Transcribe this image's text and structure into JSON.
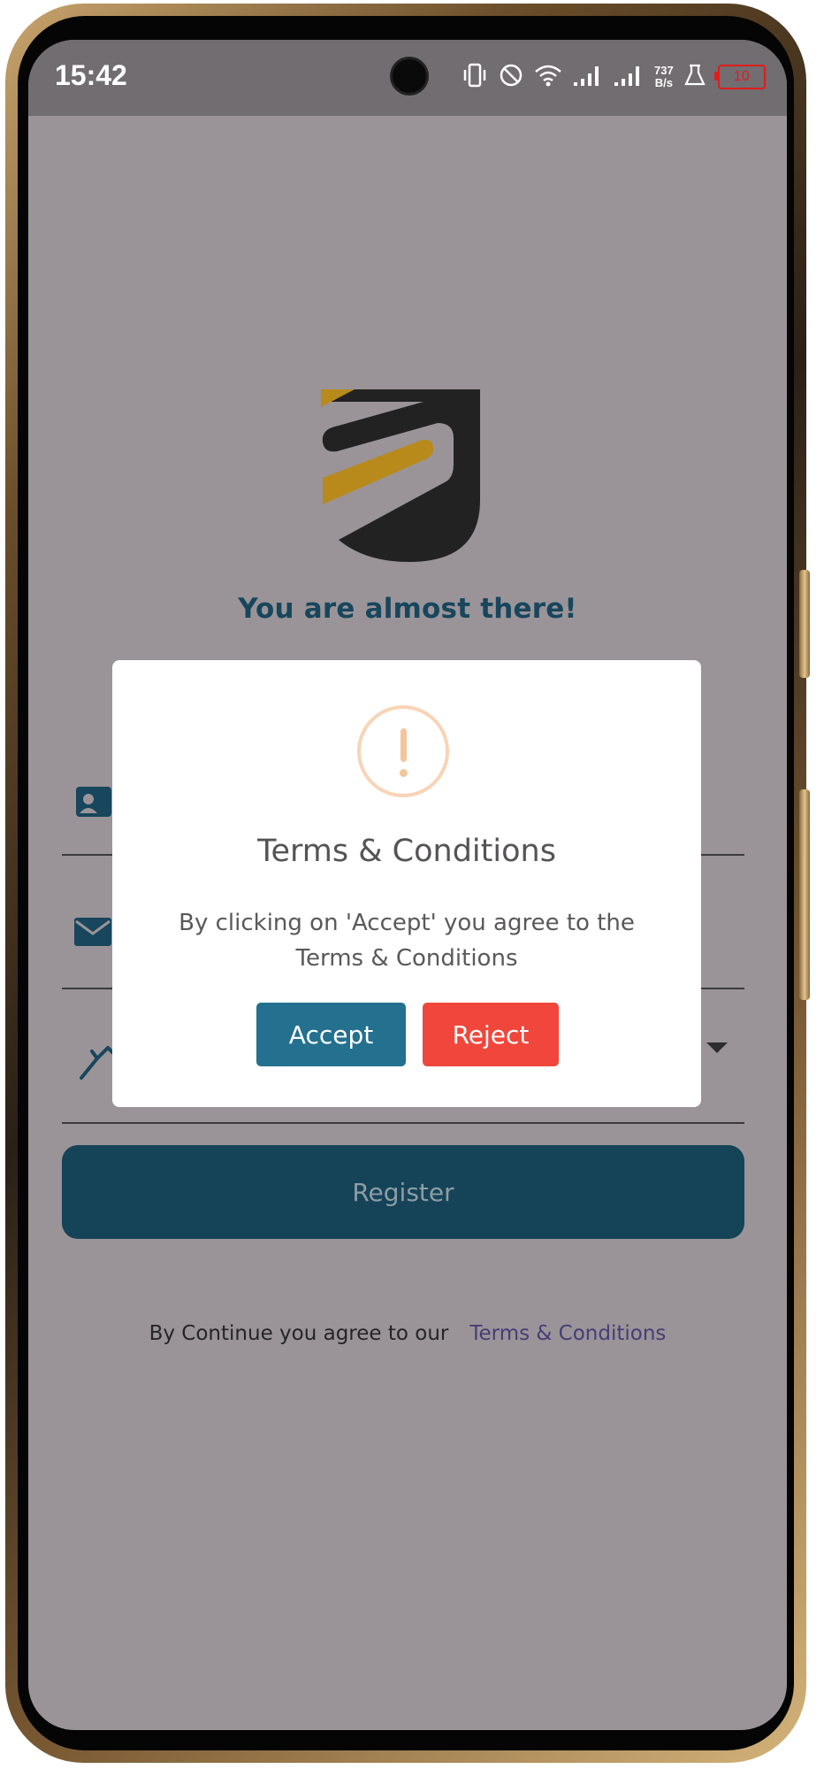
{
  "status_bar": {
    "time": "15:42",
    "net_speed_value": "737",
    "net_speed_unit": "B/s",
    "battery_level": "10",
    "icons": [
      "vibrate-icon",
      "dnd-icon",
      "wifi-icon",
      "signal-icon",
      "signal-icon",
      "lab-icon",
      "battery-icon"
    ]
  },
  "app": {
    "heading": "You are almost there!",
    "register_label": "Register",
    "consent_text": "By Continue you agree to our",
    "terms_link": "Terms & Conditions"
  },
  "dialog": {
    "title": "Terms & Conditions",
    "message": "By clicking on 'Accept' you agree to the Terms & Conditions",
    "accept_label": "Accept",
    "reject_label": "Reject"
  },
  "colors": {
    "overlay": "#9a9498",
    "brand_dark": "#154357",
    "accent_gold": "#b88a1b",
    "accept": "#24708f",
    "reject": "#f1463b"
  }
}
